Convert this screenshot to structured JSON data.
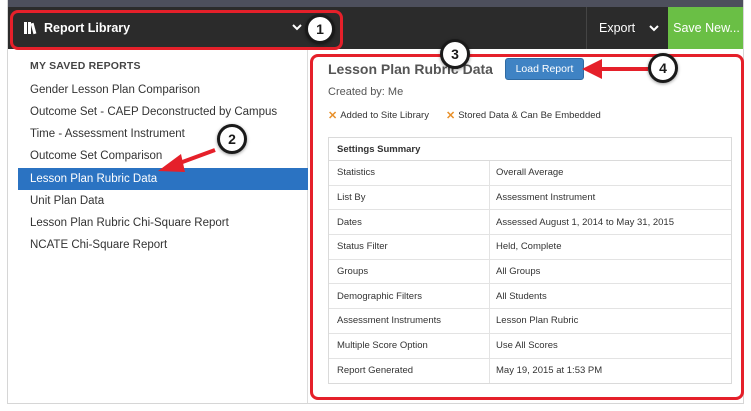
{
  "toolbar": {
    "library_label": "Report Library",
    "export_label": "Export",
    "save_new_label": "Save New..."
  },
  "sidebar": {
    "heading": "MY SAVED REPORTS",
    "items": [
      {
        "label": "Gender Lesson Plan Comparison"
      },
      {
        "label": "Outcome Set - CAEP Deconstructed by Campus"
      },
      {
        "label": "Time - Assessment Instrument"
      },
      {
        "label": "Outcome Set Comparison"
      },
      {
        "label": "Lesson Plan Rubric Data",
        "active": true
      },
      {
        "label": "Unit Plan Data"
      },
      {
        "label": "Lesson Plan Rubric Chi-Square Report"
      },
      {
        "label": "NCATE Chi-Square Report"
      }
    ]
  },
  "report": {
    "title": "Lesson Plan Rubric Data",
    "load_label": "Load Report",
    "created_by": "Created by: Me",
    "flags": [
      "Added to Site Library",
      "Stored Data & Can Be Embedded"
    ]
  },
  "settings": {
    "heading": "Settings Summary",
    "rows": [
      {
        "key": "Statistics",
        "value": "Overall Average"
      },
      {
        "key": "List By",
        "value": "Assessment Instrument"
      },
      {
        "key": "Dates",
        "value": "Assessed August 1, 2014 to May 31, 2015"
      },
      {
        "key": "Status Filter",
        "value": "Held, Complete"
      },
      {
        "key": "Groups",
        "value": "All Groups"
      },
      {
        "key": "Demographic Filters",
        "value": "All Students"
      },
      {
        "key": "Assessment Instruments",
        "value": "Lesson Plan Rubric"
      },
      {
        "key": "Multiple Score Option",
        "value": "Use All Scores"
      },
      {
        "key": "Report Generated",
        "value": "May 19, 2015 at 1:53 PM"
      }
    ]
  },
  "callouts": [
    "1",
    "2",
    "3",
    "4"
  ],
  "colors": {
    "toolbar_bg": "#2b2b2b",
    "save_button": "#6abf45",
    "active_item": "#2b73c2",
    "load_button": "#3f83c4",
    "callout_red": "#e5202a",
    "flag_orange": "#e8902a"
  }
}
